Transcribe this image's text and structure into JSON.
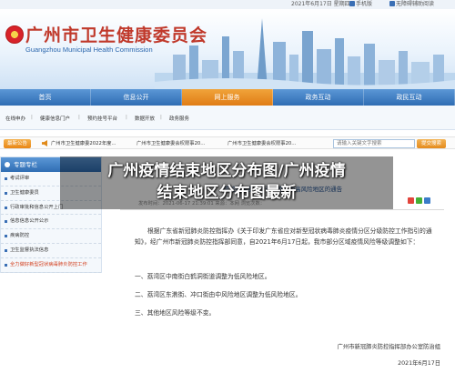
{
  "topbar": {
    "date": "2021年6月17日 星期四",
    "mobile": "手机版",
    "accessibility": "无障碍辅助阅读"
  },
  "header": {
    "title": "广州市卫生健康委员会",
    "subtitle_en": "Guangzhou Municipal Health Commission"
  },
  "main_nav": [
    {
      "label": "首页",
      "active": false
    },
    {
      "label": "信息公开",
      "active": false
    },
    {
      "label": "网上服务",
      "active": true
    },
    {
      "label": "政务互动",
      "active": false
    },
    {
      "label": "政民互动",
      "active": false
    }
  ],
  "sub_nav": [
    "在线申办",
    "健康信息门户",
    "预约挂号平台",
    "数据开放",
    "政务服务"
  ],
  "notice": {
    "label": "最新公告",
    "items": [
      "广州市卫生健康委2022年度...",
      "广州市卫生健康委会权限事20...",
      "广州市卫生健康委会权限事20..."
    ],
    "search_placeholder": "请输入关键文字搜索",
    "search_button": "提交搜索"
  },
  "sidebar": {
    "heading": "专题专栏",
    "items": [
      {
        "label": "考试评审",
        "current": false
      },
      {
        "label": "卫生健康委员",
        "current": false
      },
      {
        "label": "行政审批和信息公开上门",
        "current": false
      },
      {
        "label": "信息信息公开公示",
        "current": false
      },
      {
        "label": "疾病防控",
        "current": false
      },
      {
        "label": "卫生监督执法信息",
        "current": false
      },
      {
        "label": "全力做好新型冠状病毒肺炎防控工作",
        "current": true
      }
    ]
  },
  "overlay": {
    "line1": "广州疫情结束地区分布图/广州疫情",
    "line2": "结束地区分布图最新"
  },
  "article": {
    "title": "...防控指挥部关于调整疫情中高风险地区的通告",
    "meta": "发布时间：2021-06-17 21:39:01  来源：本网  浏览次数：",
    "para1": "根据广东省新冠肺炎防控指挥办《关于印发广东省应对新型冠状病毒肺炎疫情分区分级防控工作指引的通知》，经广州市新冠肺炎防控指挥部同意，自2021年6月17日起，我市部分区域疫情风险等级调整如下：",
    "list": [
      "一、荔湾区中南街白鹤洞街道调整为低风险地区。",
      "二、荔湾区东漖街、冲口街由中风险地区调整为低风险地区。",
      "三、其他地区风险等级不变。"
    ],
    "signature": "广州市新冠肺炎防控指挥部办公室防治组",
    "sign_date": "2021年6月17日"
  },
  "colors": {
    "nav_blue": "#2f6db3",
    "nav_active": "#e07d16",
    "title_red": "#c0392b"
  }
}
